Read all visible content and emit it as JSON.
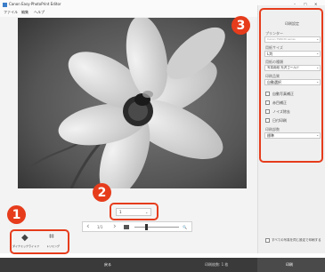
{
  "window": {
    "title": "Canon Easy-PhotoPrint Editor",
    "menu": [
      "ファイル",
      "編集",
      "ヘルプ"
    ],
    "controls": [
      "–",
      "□",
      "✕"
    ]
  },
  "markers": [
    "1",
    "2",
    "3"
  ],
  "bottom_tools": {
    "fill_light": "ダイナミックライトフィルター",
    "trimming": "トリミング"
  },
  "zoom": {
    "page_value": "1",
    "page_total": "1/1"
  },
  "print_settings": {
    "header": "印刷設定",
    "printer_label": "プリンター",
    "printer_value": "Canon TS8030 series",
    "size_label": "用紙サイズ",
    "size_value": "L判",
    "paper_label": "用紙の種類",
    "paper_value": "写真用紙 光沢ゴールド",
    "print_area_label": "印刷品質",
    "print_area_value": "自動選択",
    "checkbox_1": "自動写真補正",
    "checkbox_2": "赤目補正",
    "checkbox_3": "ノイズ除去",
    "checkbox_4": "日付印刷",
    "copies_label": "印刷部数",
    "copies_value": "標準"
  },
  "bottom_right": {
    "note": "すべての写真を同じ設定で印刷する"
  },
  "footer": {
    "center": "戻る",
    "right": "印刷",
    "info": "印刷枚数: 1 枚"
  },
  "colors": {
    "accent": "#e63c1c",
    "footer": "#3a3a3a"
  }
}
